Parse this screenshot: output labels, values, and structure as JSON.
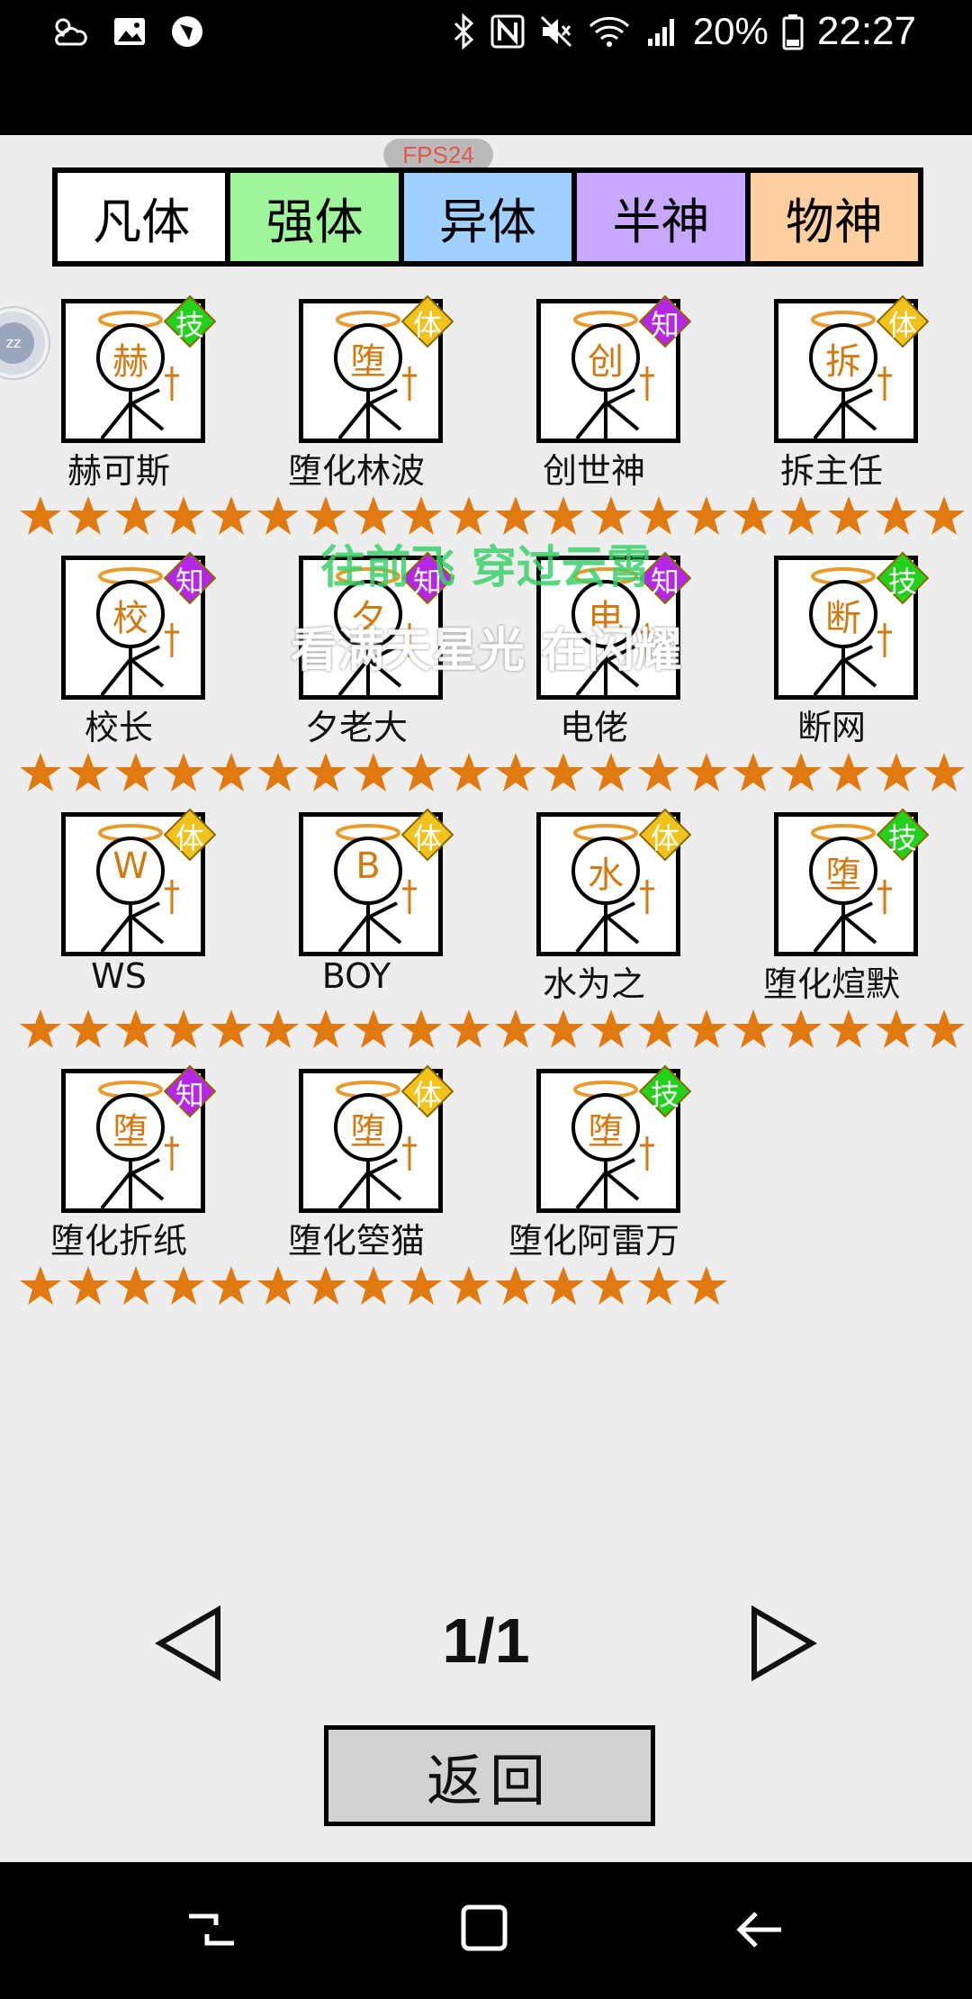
{
  "status_bar": {
    "icons_left": [
      "weather-icon",
      "gallery-icon",
      "browser-icon"
    ],
    "icons_right": [
      "bluetooth-icon",
      "nfc-icon",
      "mute-icon",
      "wifi-icon",
      "signal-icon"
    ],
    "battery_percent": "20%",
    "time": "22:27"
  },
  "overlay": {
    "fps": "FPS24"
  },
  "tabs": [
    {
      "label": "凡体",
      "color": "#ffffff"
    },
    {
      "label": "强体",
      "color": "#9ef59a"
    },
    {
      "label": "异体",
      "color": "#9fd0ff"
    },
    {
      "label": "半神",
      "color": "#c8a7ff"
    },
    {
      "label": "物神",
      "color": "#ffcfa0"
    }
  ],
  "characters": [
    {
      "name": "赫可斯",
      "face": "赫",
      "badge": "技",
      "badge_color": "#22d11c",
      "stars": 5
    },
    {
      "name": "堕化林波",
      "face": "堕",
      "badge": "体",
      "badge_color": "#f2c21c",
      "stars": 5
    },
    {
      "name": "创世神",
      "face": "创",
      "badge": "知",
      "badge_color": "#b626e6",
      "stars": 5
    },
    {
      "name": "拆主任",
      "face": "拆",
      "badge": "体",
      "badge_color": "#f2c21c",
      "stars": 5
    },
    {
      "name": "校长",
      "face": "校",
      "badge": "知",
      "badge_color": "#b626e6",
      "stars": 5
    },
    {
      "name": "夕老大",
      "face": "夕",
      "badge": "知",
      "badge_color": "#b626e6",
      "stars": 5
    },
    {
      "name": "电佬",
      "face": "电",
      "badge": "知",
      "badge_color": "#b626e6",
      "stars": 5
    },
    {
      "name": "断网",
      "face": "断",
      "badge": "技",
      "badge_color": "#22d11c",
      "stars": 5
    },
    {
      "name": "WS",
      "face": "W",
      "badge": "体",
      "badge_color": "#f2c21c",
      "stars": 5
    },
    {
      "name": "BOY",
      "face": "B",
      "badge": "体",
      "badge_color": "#f2c21c",
      "stars": 5
    },
    {
      "name": "水为之",
      "face": "水",
      "badge": "体",
      "badge_color": "#f2c21c",
      "stars": 5
    },
    {
      "name": "堕化煊默",
      "face": "堕",
      "badge": "技",
      "badge_color": "#22d11c",
      "stars": 5
    },
    {
      "name": "堕化折纸",
      "face": "堕",
      "badge": "知",
      "badge_color": "#b626e6",
      "stars": 5
    },
    {
      "name": "堕化箜猫",
      "face": "堕",
      "badge": "体",
      "badge_color": "#f2c21c",
      "stars": 5
    },
    {
      "name": "堕化阿雷万",
      "face": "堕",
      "badge": "技",
      "badge_color": "#22d11c",
      "stars": 5
    }
  ],
  "lyrics": {
    "line1": "往前飞 穿过云霄",
    "line2": "看满天星光 在闪耀"
  },
  "pager": {
    "page": "1/1"
  },
  "back_button": "返回",
  "colors": {
    "background": "#ededed",
    "star": "#e07a10",
    "face_text": "#d27a12",
    "halo": "#e89a2a"
  }
}
